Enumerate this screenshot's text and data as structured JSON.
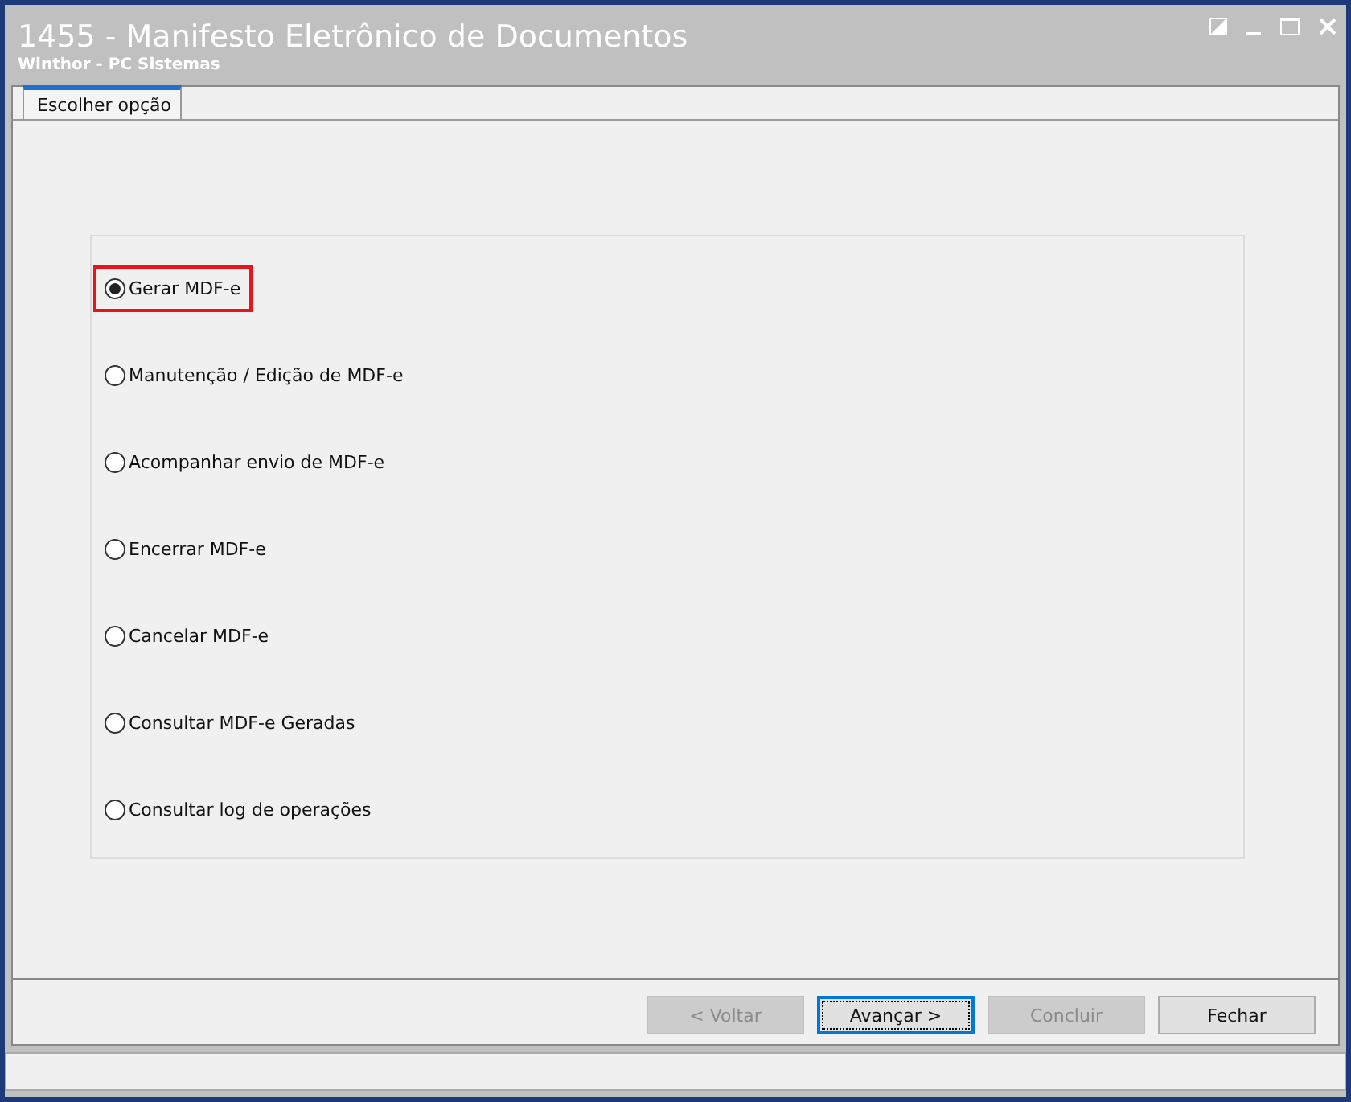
{
  "window": {
    "title": "1455 - Manifesto Eletrônico de Documentos",
    "subtitle": "Winthor - PC Sistemas"
  },
  "tabs": [
    {
      "label": "Escolher opção",
      "selected": true
    }
  ],
  "options": [
    {
      "label": "Gerar MDF-e",
      "selected": true,
      "highlighted": true
    },
    {
      "label": "Manutenção / Edição de MDF-e",
      "selected": false,
      "highlighted": false
    },
    {
      "label": "Acompanhar envio de MDF-e",
      "selected": false,
      "highlighted": false
    },
    {
      "label": "Encerrar MDF-e",
      "selected": false,
      "highlighted": false
    },
    {
      "label": "Cancelar MDF-e",
      "selected": false,
      "highlighted": false
    },
    {
      "label": "Consultar MDF-e Geradas",
      "selected": false,
      "highlighted": false
    },
    {
      "label": "Consultar log de operações",
      "selected": false,
      "highlighted": false
    }
  ],
  "buttons": [
    {
      "label": "< Voltar",
      "disabled": true,
      "focused": false
    },
    {
      "label": "Avançar >",
      "disabled": false,
      "focused": true
    },
    {
      "label": "Concluir",
      "disabled": true,
      "focused": false
    },
    {
      "label": "Fechar",
      "disabled": false,
      "focused": false
    }
  ]
}
